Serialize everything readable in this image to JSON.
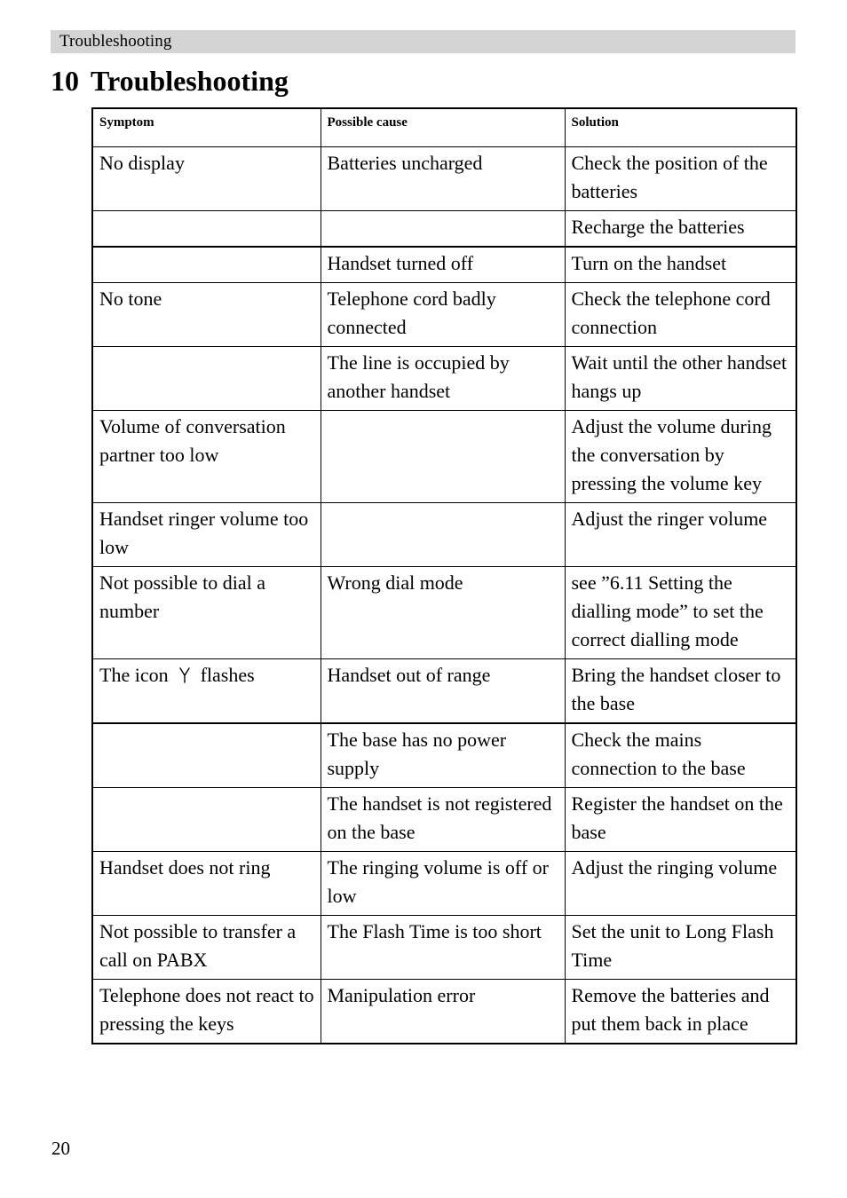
{
  "page": {
    "running_header": "Troubleshooting",
    "chapter_number": "10",
    "chapter_title": "Troubleshooting",
    "page_number": "20",
    "header_band_color": "#d4d4d4",
    "text_color": "#000000"
  },
  "table": {
    "columns": [
      {
        "key": "symptom",
        "header": "Symptom"
      },
      {
        "key": "cause",
        "header": "Possible cause"
      },
      {
        "key": "solution",
        "header": "Solution"
      }
    ],
    "rows": [
      {
        "symptom": "No display",
        "cause": "Batteries uncharged",
        "solution": "Check the position of the batteries"
      },
      {
        "symptom": "",
        "cause": "",
        "solution": "Recharge the batteries"
      },
      {
        "symptom": "",
        "cause": "Handset turned off",
        "solution": "Turn on the handset"
      },
      {
        "symptom": "No tone",
        "cause": "Telephone cord badly connected",
        "solution": "Check the telephone cord connection"
      },
      {
        "symptom": "",
        "cause": "The line is occupied by another handset",
        "solution": "Wait until the other handset hangs up"
      },
      {
        "symptom": "Volume of conversation partner too low",
        "cause": "",
        "solution": "Adjust the volume during the conversation by pressing the volume key"
      },
      {
        "symptom": "Handset ringer volume too low",
        "cause": "",
        "solution": "Adjust the ringer volume"
      },
      {
        "symptom": "Not possible to dial a number",
        "cause": "Wrong dial mode",
        "solution": "see ”6.11 Setting the dialling mode” to set the correct dialling mode"
      },
      {
        "symptom_before_icon": "The icon",
        "symptom_icon": "antenna-icon",
        "symptom_after_icon": "flashes",
        "symptom": "",
        "cause": "Handset out of range",
        "solution": "Bring the handset closer to the base"
      },
      {
        "symptom": "",
        "cause": "The base has no power supply",
        "solution": "Check the mains connection to the base"
      },
      {
        "symptom": "",
        "cause": "The handset is not registered on the base",
        "solution": "Register the handset on the base"
      },
      {
        "symptom": "Handset does not ring",
        "cause": "The ringing volume is off or low",
        "solution": "Adjust the ringing volume"
      },
      {
        "symptom": "Not possible to transfer a call on PABX",
        "cause": "The Flash Time is too short",
        "solution": "Set the unit to Long Flash Time"
      },
      {
        "symptom": "Telephone does not react to pressing the keys",
        "cause": "Manipulation error",
        "solution": "Remove the batteries and put them back in place"
      }
    ]
  }
}
